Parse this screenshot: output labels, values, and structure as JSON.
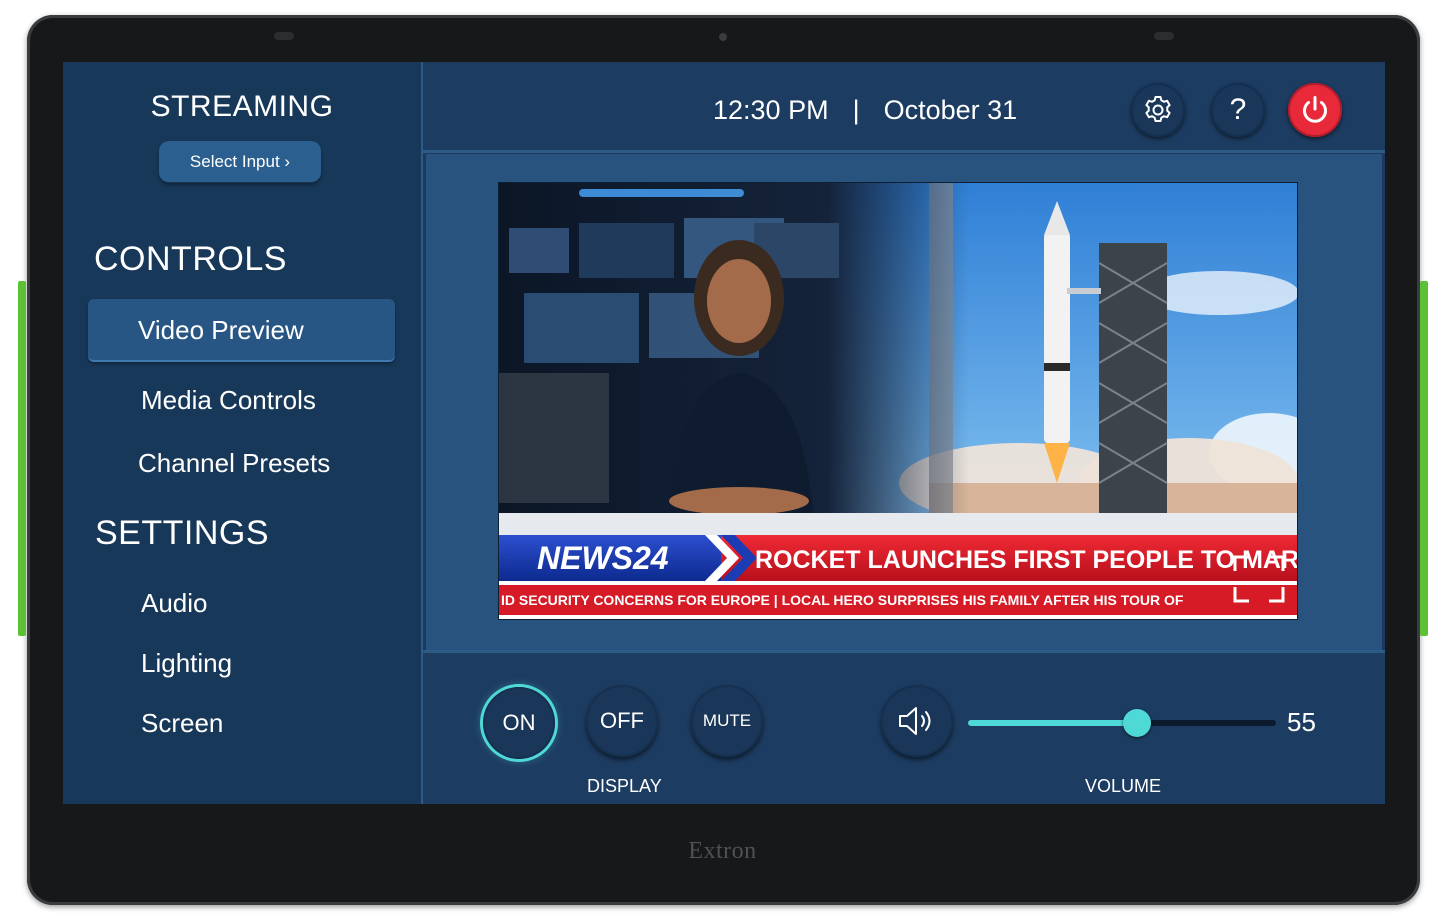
{
  "device": {
    "brand": "Extron"
  },
  "sidebar": {
    "streaming_title": "STREAMING",
    "select_input_label": "Select Input ›",
    "controls_title": "CONTROLS",
    "controls_items": [
      {
        "label": "Video Preview",
        "active": true
      },
      {
        "label": "Media Controls",
        "active": false
      },
      {
        "label": "Channel Presets",
        "active": false
      }
    ],
    "settings_title": "SETTINGS",
    "settings_items": [
      {
        "label": "Audio"
      },
      {
        "label": "Lighting"
      },
      {
        "label": "Screen"
      }
    ]
  },
  "header": {
    "time": "12:30 PM",
    "separator": "|",
    "date": "October 31",
    "icons": [
      "gear-icon",
      "help-icon",
      "power-icon"
    ],
    "help_glyph": "?"
  },
  "preview": {
    "logo": "NEWS24",
    "headline": "ROCKET LAUNCHES FIRST PEOPLE TO MARS",
    "ticker": "ID SECURITY CONCERNS FOR EUROPE  |  LOCAL HERO SURPRISES HIS FAMILY AFTER HIS TOUR OF"
  },
  "controls": {
    "display_buttons": [
      {
        "label": "ON",
        "selected": true
      },
      {
        "label": "OFF",
        "selected": false
      },
      {
        "label": "MUTE",
        "selected": false
      }
    ],
    "display_label": "DISPLAY",
    "volume_label": "VOLUME",
    "volume_value": "55",
    "volume_fraction": 0.55
  },
  "colors": {
    "accent": "#4fd9d6",
    "power": "#e8293a",
    "panel": "#1c3a5e",
    "led": "#5bc236"
  }
}
